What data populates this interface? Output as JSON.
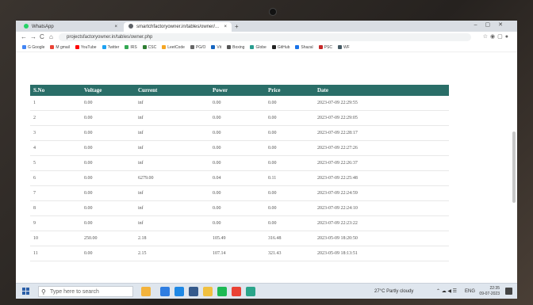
{
  "browser": {
    "tabs": [
      {
        "label": "WhatsApp",
        "icon": "whatsapp-icon",
        "color": "#25d366"
      },
      {
        "label": "smartchfactoryowner.in/tables/owner/...",
        "icon": "globe-icon",
        "color": "#5f6368"
      }
    ],
    "url": "projectsfactoryowner.in/tables/owner.php",
    "bookmarks": [
      "G Google",
      "M gmail",
      "YouTube",
      "Twitter",
      "IRS",
      "CSC",
      "LeetCode",
      "PG/O",
      "Vit",
      "Boxing",
      "Globe",
      "GitHub",
      "Shazal",
      "PSC",
      "WF"
    ]
  },
  "table": {
    "headers": [
      "S.No",
      "Voltage",
      "Current",
      "Power",
      "Price",
      "Date"
    ],
    "rows": [
      [
        "1",
        "0.00",
        "inf",
        "0.00",
        "0.00",
        "2023-07-09 22:29:55"
      ],
      [
        "2",
        "0.00",
        "inf",
        "0.00",
        "0.00",
        "2023-07-09 22:29:05"
      ],
      [
        "3",
        "0.00",
        "inf",
        "0.00",
        "0.00",
        "2023-07-09 22:28:17"
      ],
      [
        "4",
        "0.00",
        "inf",
        "0.00",
        "0.00",
        "2023-07-09 22:27:26"
      ],
      [
        "5",
        "0.00",
        "inf",
        "0.00",
        "0.00",
        "2023-07-09 22:26:37"
      ],
      [
        "6",
        "0.00",
        "6279.00",
        "0.04",
        "0.11",
        "2023-07-09 22:25:48"
      ],
      [
        "7",
        "0.00",
        "inf",
        "0.00",
        "0.00",
        "2023-07-09 22:24:59"
      ],
      [
        "8",
        "0.00",
        "inf",
        "0.00",
        "0.00",
        "2023-07-09 22:24:10"
      ],
      [
        "9",
        "0.00",
        "inf",
        "0.00",
        "0.00",
        "2023-07-09 22:23:22"
      ],
      [
        "10",
        "250.00",
        "2.18",
        "105.49",
        "316.48",
        "2023-05-09 18:20:50"
      ],
      [
        "11",
        "0.00",
        "2.15",
        "107.14",
        "321.43",
        "2023-05-09 18:13:51"
      ]
    ],
    "header_color": "#2a6e68"
  },
  "taskbar": {
    "search_placeholder": "Type here to search",
    "weather": "27°C Partly cloudy",
    "lang": "ENG",
    "time": "22:35",
    "date": "09-07-2023",
    "apps": [
      {
        "name": "taskview-icon",
        "color": "#f3b33d"
      },
      {
        "name": "explorer-icon",
        "color": "#2f7de1"
      },
      {
        "name": "edge-icon",
        "color": "#1e88e5"
      },
      {
        "name": "mail-icon",
        "color": "#355a8c"
      },
      {
        "name": "files-icon",
        "color": "#f0c040"
      },
      {
        "name": "spotify-icon",
        "color": "#1db954"
      },
      {
        "name": "chrome-icon",
        "color": "#e94235"
      },
      {
        "name": "app-icon",
        "color": "#2aa58a"
      }
    ]
  }
}
